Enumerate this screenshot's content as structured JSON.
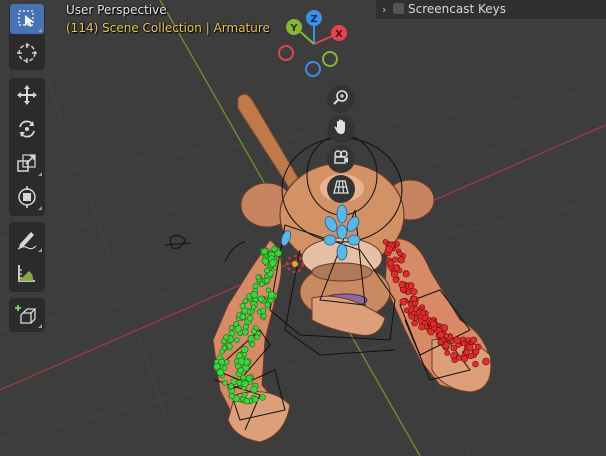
{
  "viewport": {
    "view_name": "User Perspective",
    "frame": "(114)",
    "collection": "Scene Collection",
    "separator": "|",
    "active_object": "Armature"
  },
  "gizmo": {
    "x_label": "X",
    "y_label": "Y",
    "z_label": "Z",
    "colors": {
      "x": "#e2454e",
      "y": "#87b53a",
      "z": "#3d8fe8",
      "neg_x": "#8a3138",
      "neg_y": "#5e7e2c",
      "neg_z": "#2d5a9b"
    }
  },
  "toolbar": {
    "tools": [
      {
        "name": "select-box",
        "icon": "select-box-icon",
        "active": true
      },
      {
        "name": "cursor",
        "icon": "cursor-icon",
        "active": false
      },
      {
        "name": "move",
        "icon": "move-icon",
        "active": false
      },
      {
        "name": "rotate",
        "icon": "rotate-icon",
        "active": false
      },
      {
        "name": "scale",
        "icon": "scale-icon",
        "active": false
      },
      {
        "name": "transform",
        "icon": "transform-icon",
        "active": false
      },
      {
        "name": "annotate",
        "icon": "annotate-icon",
        "active": false
      },
      {
        "name": "measure",
        "icon": "measure-icon",
        "active": false
      },
      {
        "name": "add-cube",
        "icon": "add-cube-icon",
        "active": false
      }
    ]
  },
  "navigation": {
    "zoom_icon": "zoom-icon",
    "pan_icon": "hand-icon",
    "camera_icon": "camera-icon",
    "ortho_icon": "grid-perspective-icon"
  },
  "screencast": {
    "label": "Screencast Keys",
    "checked": false
  },
  "colors": {
    "viewport_bg": "#3d3d3d",
    "grid_line": "#454545",
    "x_axis": "#9a3b40",
    "y_axis": "#6c8c2f",
    "active_tool": "#4772b3",
    "header_text": "#e8c84a",
    "left_bones": "#3ed43e",
    "right_bones": "#e22c2c",
    "head_bones": "#5ab8e8",
    "skin": "#d8916a"
  }
}
